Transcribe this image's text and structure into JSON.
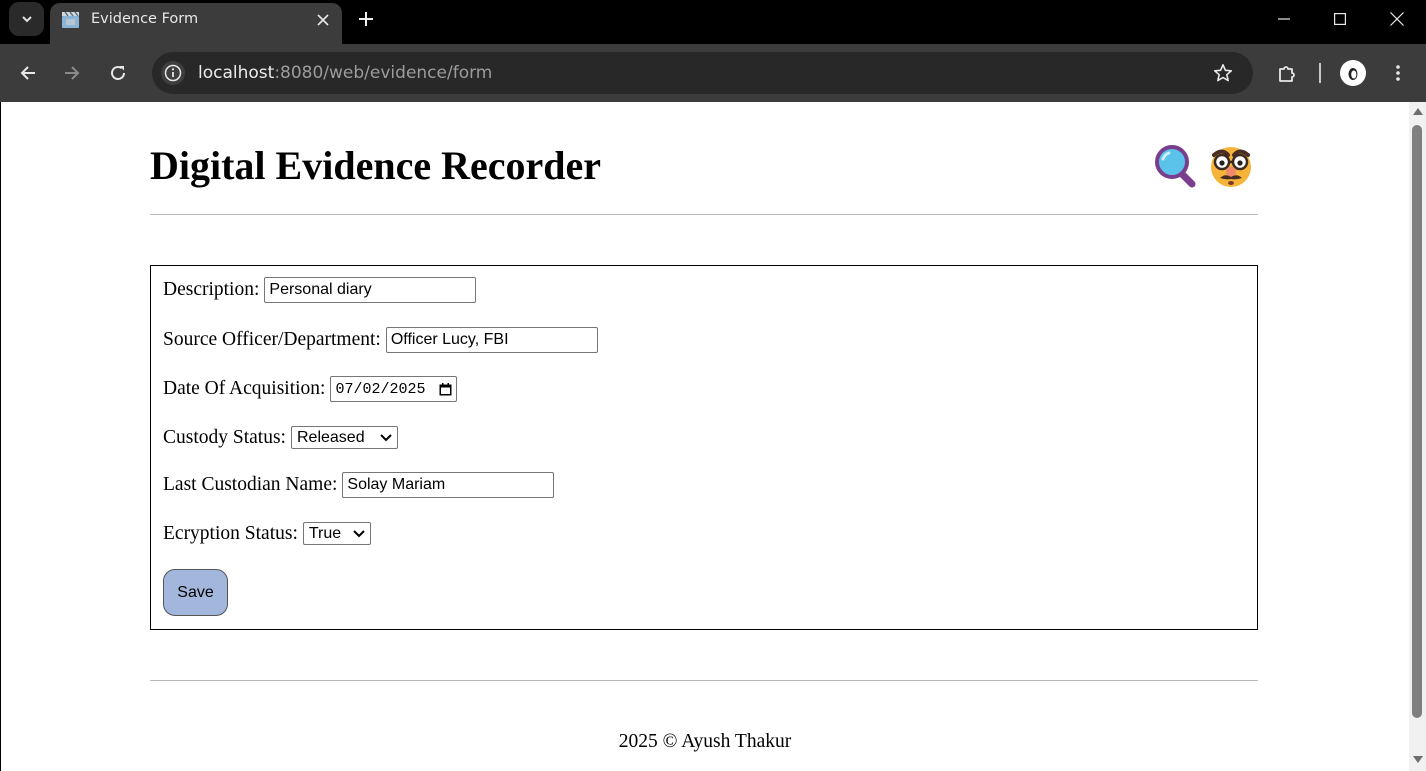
{
  "browser": {
    "tab_title": "Evidence Form",
    "url_host": "localhost",
    "url_rest": ":8080/web/evidence/form"
  },
  "page": {
    "title": "Digital Evidence Recorder",
    "header_icons": [
      "magnifying-glass-icon",
      "disguise-face-icon"
    ],
    "form": {
      "description": {
        "label": "Description:",
        "value": "Personal diary"
      },
      "source": {
        "label": "Source Officer/Department:",
        "value": "Officer Lucy, FBI"
      },
      "date": {
        "label": "Date Of Acquisition:",
        "value": "07/02/2025"
      },
      "custody": {
        "label": "Custody Status:",
        "value": "Released"
      },
      "custodian": {
        "label": "Last Custodian Name:",
        "value": "Solay Mariam"
      },
      "encryption": {
        "label": "Ecryption Status:",
        "value": "True"
      },
      "save_label": "Save"
    },
    "footer": "2025 © Ayush Thakur"
  },
  "colors": {
    "save_button": "#a3b6dc",
    "browser_toolbar": "#3c3c3c"
  }
}
